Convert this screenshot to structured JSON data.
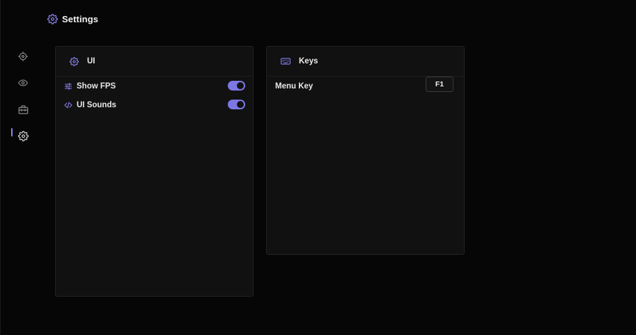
{
  "header": {
    "title": "Settings",
    "icon": "gear-icon"
  },
  "sidebar": {
    "items": [
      {
        "name": "crosshair",
        "icon": "crosshair-icon",
        "active": false
      },
      {
        "name": "eye",
        "icon": "eye-icon",
        "active": false
      },
      {
        "name": "toolbox",
        "icon": "toolbox-icon",
        "active": false
      },
      {
        "name": "settings",
        "icon": "gear-icon",
        "active": true
      }
    ]
  },
  "panels": {
    "ui": {
      "title": "UI",
      "icon": "gear-icon",
      "settings": [
        {
          "label": "Show FPS",
          "icon": "sliders-icon",
          "enabled": true
        },
        {
          "label": "UI Sounds",
          "icon": "code-icon",
          "enabled": true
        }
      ]
    },
    "keys": {
      "title": "Keys",
      "icon": "keyboard-icon",
      "bindings": [
        {
          "label": "Menu Key",
          "value": "F1"
        }
      ]
    }
  },
  "colors": {
    "accent": "#7d77e6",
    "background": "#060606",
    "panel": "#111111",
    "icon_inactive": "#8a8a8a"
  }
}
